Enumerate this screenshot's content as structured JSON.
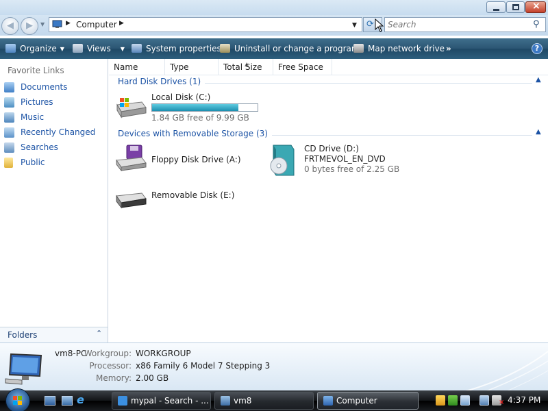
{
  "window": {
    "minimize_label": "minimize",
    "maximize_label": "maximize",
    "close_label": "close"
  },
  "address": {
    "path": "Computer",
    "search_placeholder": "Search"
  },
  "toolbar": {
    "organize": "Organize",
    "views": "Views",
    "system_properties": "System properties",
    "uninstall": "Uninstall or change a program",
    "map_drive": "Map network drive",
    "more": "»",
    "help": "?"
  },
  "nav": {
    "heading": "Favorite Links",
    "items": [
      {
        "label": "Documents",
        "icon": "documents-icon"
      },
      {
        "label": "Pictures",
        "icon": "pictures-icon"
      },
      {
        "label": "Music",
        "icon": "music-icon"
      },
      {
        "label": "Recently Changed",
        "icon": "recently-changed-icon"
      },
      {
        "label": "Searches",
        "icon": "searches-icon"
      },
      {
        "label": "Public",
        "icon": "public-folder-icon"
      }
    ],
    "folders_label": "Folders"
  },
  "columns": [
    "Name",
    "Type",
    "Total Size",
    "Free Space"
  ],
  "groups": {
    "hdd": "Hard Disk Drives (1)",
    "removable": "Devices with Removable Storage (3)"
  },
  "drives": {
    "c": {
      "name": "Local Disk (C:)",
      "free_text": "1.84 GB free of 9.99 GB",
      "used_fraction": 0.816
    },
    "a": {
      "name": "Floppy Disk Drive (A:)"
    },
    "d": {
      "name": "CD Drive (D:)",
      "label": "FRTMEVOL_EN_DVD",
      "free_text": "0 bytes free of 2.25 GB"
    },
    "e": {
      "name": "Removable Disk (E:)"
    }
  },
  "details": {
    "computer_name": "vm8-PC",
    "workgroup_key": "Workgroup:",
    "workgroup": "WORKGROUP",
    "processor_key": "Processor:",
    "processor": "x86 Family 6 Model 7 Stepping 3",
    "memory_key": "Memory:",
    "memory": "2.00 GB"
  },
  "taskbar": {
    "tasks": [
      "mypal - Search - ...",
      "vm8",
      "Computer"
    ],
    "clock": "4:37 PM"
  },
  "colors": {
    "link": "#1c53a5",
    "toolbar_dark": "#1f4865",
    "progress": "#1c8fb0"
  }
}
